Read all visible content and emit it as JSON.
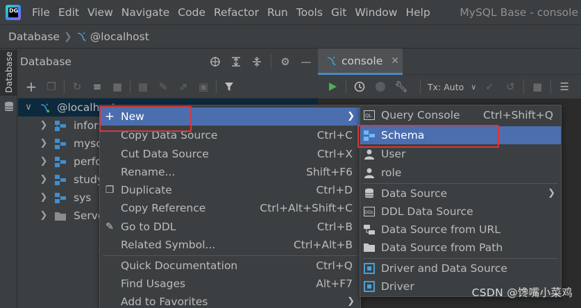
{
  "app": {
    "logo_text": "DG",
    "window_title": "MySQL Base - console"
  },
  "menubar": {
    "items": [
      "File",
      "Edit",
      "View",
      "Navigate",
      "Code",
      "Refactor",
      "Run",
      "Tools",
      "Git",
      "Window",
      "Help"
    ]
  },
  "breadcrumb": {
    "root": "Database",
    "current": "@localhost"
  },
  "stripe": {
    "tab_label": "Database"
  },
  "db_panel": {
    "title": "Database",
    "tree": {
      "root": "@localhost",
      "children": [
        "infor",
        "mysq",
        "perfo",
        "study",
        "sys",
        "Serve"
      ]
    }
  },
  "editor": {
    "tab_label": "console",
    "tx_mode": "Tx: Auto"
  },
  "context_menu": {
    "items": [
      {
        "label": "New",
        "shortcut": "",
        "submenu": true
      },
      {
        "label": "Copy Data Source",
        "shortcut": "Ctrl+C"
      },
      {
        "label": "Cut Data Source",
        "shortcut": "Ctrl+X"
      },
      {
        "label": "Rename...",
        "shortcut": "Shift+F6"
      },
      {
        "label": "Duplicate",
        "shortcut": "Ctrl+D"
      },
      {
        "label": "Copy Reference",
        "shortcut": "Ctrl+Alt+Shift+C"
      },
      {
        "label": "Go to DDL",
        "shortcut": "Ctrl+B"
      },
      {
        "label": "Related Symbol...",
        "shortcut": "Ctrl+Alt+B"
      },
      {
        "label": "Quick Documentation",
        "shortcut": "Ctrl+Q"
      },
      {
        "label": "Find Usages",
        "shortcut": "Alt+F7"
      },
      {
        "label": "Add to Favorites",
        "shortcut": "",
        "submenu": true
      }
    ]
  },
  "submenu": {
    "items": [
      {
        "label": "Query Console",
        "shortcut": "Ctrl+Shift+Q"
      },
      {
        "label": "Schema",
        "shortcut": ""
      },
      {
        "label": "User",
        "shortcut": ""
      },
      {
        "label": "role",
        "shortcut": ""
      },
      {
        "label": "Data Source",
        "shortcut": "",
        "submenu": true
      },
      {
        "label": "DDL Data Source",
        "shortcut": ""
      },
      {
        "label": "Data Source from URL",
        "shortcut": ""
      },
      {
        "label": "Data Source from Path",
        "shortcut": ""
      },
      {
        "label": "Driver and Data Source",
        "shortcut": ""
      },
      {
        "label": "Driver",
        "shortcut": ""
      }
    ]
  },
  "watermark": "CSDN @馋嘴小菜鸡",
  "colors": {
    "menu_highlight": "#4b6eaf",
    "annotation_red": "#e13434",
    "tab_underline": "#4a88c7"
  }
}
